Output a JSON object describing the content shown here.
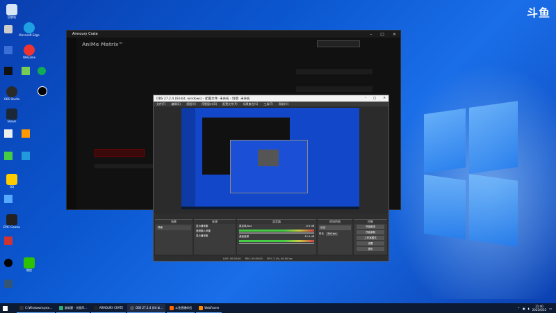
{
  "watermark": "斗鱼",
  "desktop": {
    "icons": [
      {
        "label": "回收站",
        "color": "#d8e6f5"
      },
      {
        "label": "OBS Studio",
        "color": "#2a2a2a"
      },
      {
        "label": "Steam",
        "color": "#1b2838"
      },
      {
        "label": "QQ",
        "color": "#ffcc00"
      },
      {
        "label": "EPIC Games",
        "color": "#222"
      },
      {
        "label": "WeGame",
        "color": "#e33"
      },
      {
        "label": "Microsoft Edge",
        "color": "#1fa0e3"
      },
      {
        "label": "微信",
        "color": "#2dc100"
      }
    ]
  },
  "armoury": {
    "title": "Armoury Crate",
    "heading": "AniMe Matrix™"
  },
  "obs": {
    "title": "OBS 27.2.4 (64-bit, windows) - 配置文件: 未命名 - 场景: 未命名",
    "menu": [
      "文件(F)",
      "编辑(E)",
      "视图(V)",
      "停靠窗口(D)",
      "配置文件(P)",
      "场景集合(S)",
      "工具(T)",
      "帮助(H)"
    ],
    "panels": {
      "scenes": "场景",
      "sources": "来源",
      "mixer": "混音器",
      "transitions": "转场特效",
      "controls": "控制"
    },
    "scene_item": "场景",
    "sources": [
      "显示器采集",
      "音频输入采集",
      "显示器采集"
    ],
    "mixer_tracks": [
      {
        "name": "麦克风/Aux",
        "db": "-0.0 dB"
      },
      {
        "name": "桌面音频",
        "db": "-12.4 dB"
      }
    ],
    "transition": "淡出",
    "duration_label": "时长",
    "duration_value": "300 ms",
    "controls": [
      "开始推流",
      "开始录制",
      "工作室模式",
      "设置",
      "退出"
    ],
    "status": [
      "LIVE: 00:00:00",
      "REC: 00:00:00",
      "CPU: 2.1%, 60.00 fps"
    ]
  },
  "taskbar": {
    "items": [
      {
        "label": "C:\\Windows\\syste...",
        "color": "#333"
      },
      {
        "label": "副标题 - 光照声...",
        "color": "#3a7"
      },
      {
        "label": "ARMOURY CRATE",
        "color": "#222"
      },
      {
        "label": "OBS 27.2.4 (64-bi...",
        "color": "#555"
      },
      {
        "label": "斗鱼直播伴侣",
        "color": "#f60"
      },
      {
        "label": "WebFrame",
        "color": "#f80"
      }
    ],
    "time": "21:40",
    "date": "2022/6/22"
  }
}
